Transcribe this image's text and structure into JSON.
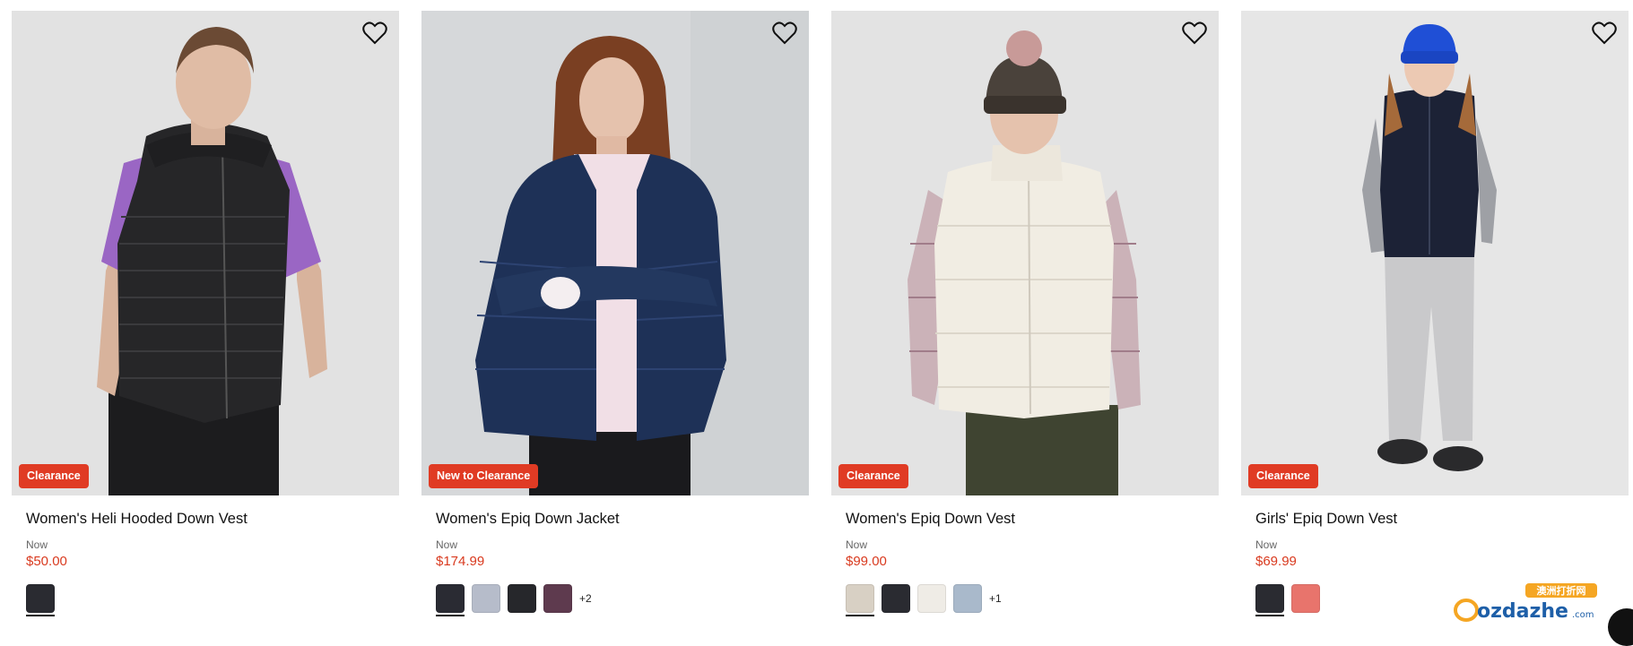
{
  "products": [
    {
      "title": "Women's Heli Hooded Down Vest",
      "now_label": "Now",
      "price": "$50.00",
      "badge": "Clearance",
      "image": "woman-black-hooded-vest",
      "swatches": [
        "#2a2b31"
      ],
      "more": ""
    },
    {
      "title": "Women's Epiq Down Jacket",
      "now_label": "Now",
      "price": "$174.99",
      "badge": "New to Clearance",
      "image": "woman-navy-down-jacket",
      "swatches": [
        "#2a2b33",
        "#b6bcca",
        "#26272b",
        "#5e3a4e"
      ],
      "more": "+2"
    },
    {
      "title": "Women's Epiq Down Vest",
      "now_label": "Now",
      "price": "$99.00",
      "badge": "Clearance",
      "image": "woman-cream-down-vest",
      "swatches": [
        "#d8d0c4",
        "#2a2b31",
        "#efece6",
        "#a9b9cb"
      ],
      "more": "+1"
    },
    {
      "title": "Girls' Epiq Down Vest",
      "now_label": "Now",
      "price": "$69.99",
      "badge": "Clearance",
      "image": "girl-navy-down-vest",
      "swatches": [
        "#2a2b31",
        "#e8746c"
      ],
      "more": ""
    }
  ],
  "watermark": {
    "brand": "ozdazhe",
    "suffix": ".com",
    "tagline": "澳洲打折网"
  },
  "colors": {
    "badge": "#e03b24",
    "price": "#d93a1f"
  }
}
